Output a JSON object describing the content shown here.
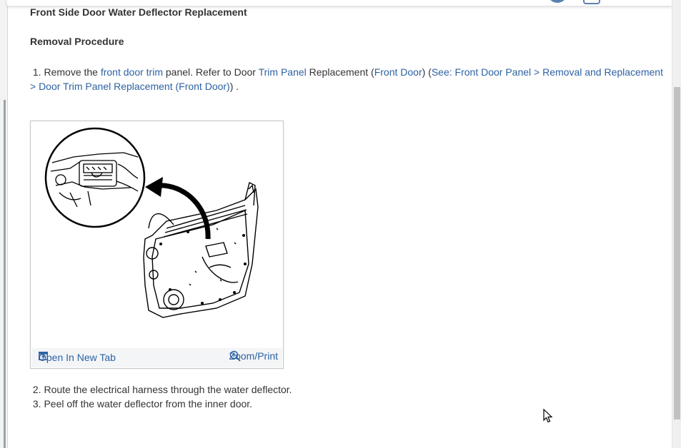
{
  "title": "Front Side Door Water Deflector Replacement",
  "section": "Removal Procedure",
  "step1": {
    "num": "1.",
    "t1": "Remove the ",
    "l1": "front door trim",
    "t2": " panel. Refer to Door ",
    "l2": "Trim Panel",
    "t3": " Replacement (",
    "l3": "Front Door",
    "t4": ") (",
    "l4": "See: Front Door Panel > Removal and Replacement > Door Trim Panel Replacement (Front Door)",
    "t5": ") ."
  },
  "figure": {
    "open_tab": "Open In New Tab",
    "zoom_print": "Zoom/Print"
  },
  "step2": {
    "num": "2.",
    "text": "Route the electrical harness through the water deflector."
  },
  "step3": {
    "num": "3.",
    "text": "Peel off the water deflector from the inner door."
  },
  "icons": {
    "open_tab": "open-in-new-tab-icon",
    "zoom": "zoom-in-icon",
    "cursor": "mouse-pointer-icon"
  },
  "colors": {
    "link": "#2d62a3",
    "text": "#333333",
    "scroll_thumb": "#c1c1c1"
  }
}
